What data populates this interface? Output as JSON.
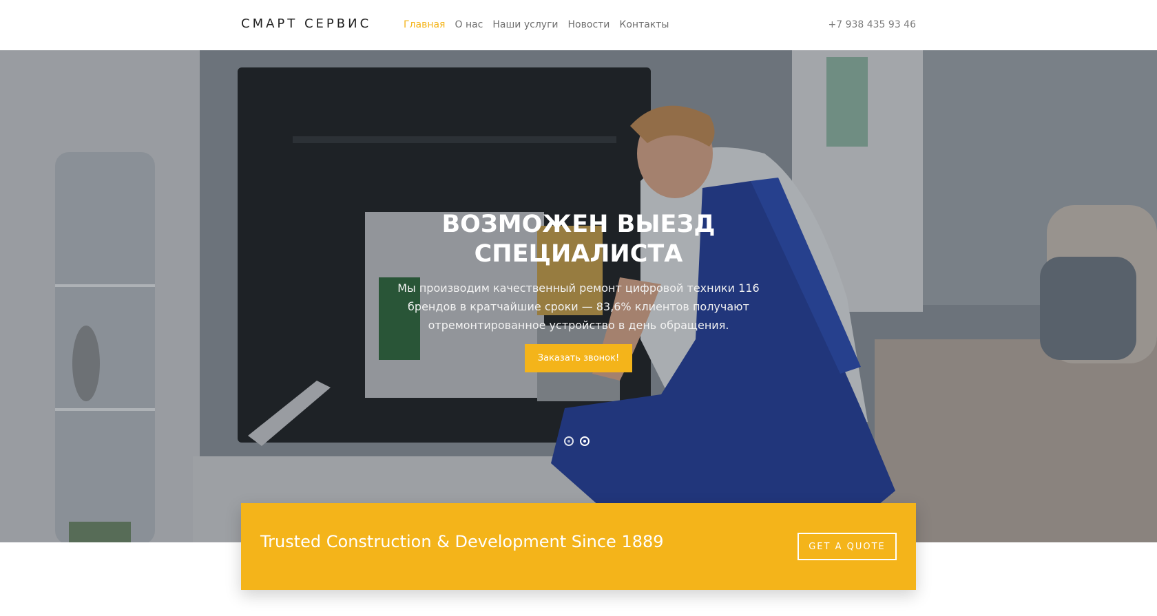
{
  "header": {
    "logo": "СМАРТ СЕРВИС",
    "nav": [
      {
        "label": "Главная",
        "active": true
      },
      {
        "label": "О нас",
        "active": false
      },
      {
        "label": "Наши услуги",
        "active": false
      },
      {
        "label": "Новости",
        "active": false
      },
      {
        "label": "Контакты",
        "active": false
      }
    ],
    "phone": "+7 938 435 93 46"
  },
  "hero": {
    "title": "ВОЗМОЖЕН ВЫЕЗД СПЕЦИАЛИСТА",
    "text": "Мы производим качественный ремонт цифровой техники 116 брендов в кратчайшие сроки — 83,6% клиентов получают отремонтированное устройство в день обращения.",
    "button_label": "Заказать звонок!",
    "slides_count": 2,
    "active_slide": 2,
    "image": "technician-repairing-tv"
  },
  "cta": {
    "text": "Trusted Construction & Development Since 1889",
    "button_label": "GET A QUOTE"
  },
  "colors": {
    "accent": "#f4b41a",
    "nav_text": "#6f6f6f",
    "logo_text": "#222222"
  }
}
